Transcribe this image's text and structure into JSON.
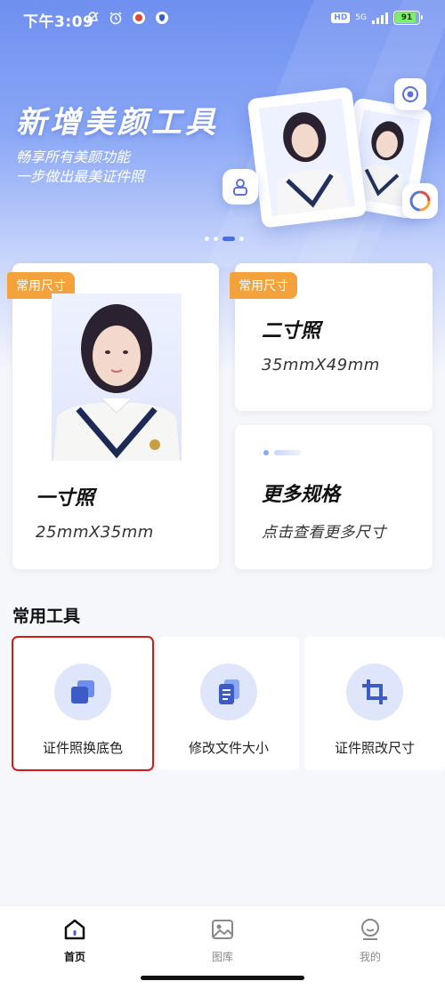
{
  "status_bar": {
    "time": "下午3:09",
    "hd": "HD",
    "network": "5G",
    "battery": "91"
  },
  "banner": {
    "title": "新增美颜工具",
    "subtitle_line1": "畅享所有美颜功能",
    "subtitle_line2": "一步做出最美证件照",
    "active_page": 3,
    "page_count": 4
  },
  "cards": {
    "one_inch": {
      "tag": "常用尺寸",
      "title": "一寸照",
      "size": "25mmX35mm"
    },
    "two_inch": {
      "tag": "常用尺寸",
      "title": "二寸照",
      "size": "35mmX49mm"
    },
    "more": {
      "title": "更多规格",
      "subtitle": "点击查看更多尺寸"
    }
  },
  "tools_section": {
    "title": "常用工具",
    "items": [
      {
        "label": "证件照换底色",
        "icon": "layers-icon"
      },
      {
        "label": "修改文件大小",
        "icon": "document-icon"
      },
      {
        "label": "证件照改尺寸",
        "icon": "crop-icon"
      }
    ]
  },
  "bottom_nav": {
    "items": [
      {
        "label": "首页",
        "icon": "home-icon",
        "active": true
      },
      {
        "label": "图库",
        "icon": "gallery-icon",
        "active": false
      },
      {
        "label": "我的",
        "icon": "profile-icon",
        "active": false
      }
    ]
  },
  "colors": {
    "accent": "#4a6fe0",
    "tag": "#f4a23b",
    "tool_circle": "#dfe6fb",
    "selection": "#d21a1a"
  }
}
